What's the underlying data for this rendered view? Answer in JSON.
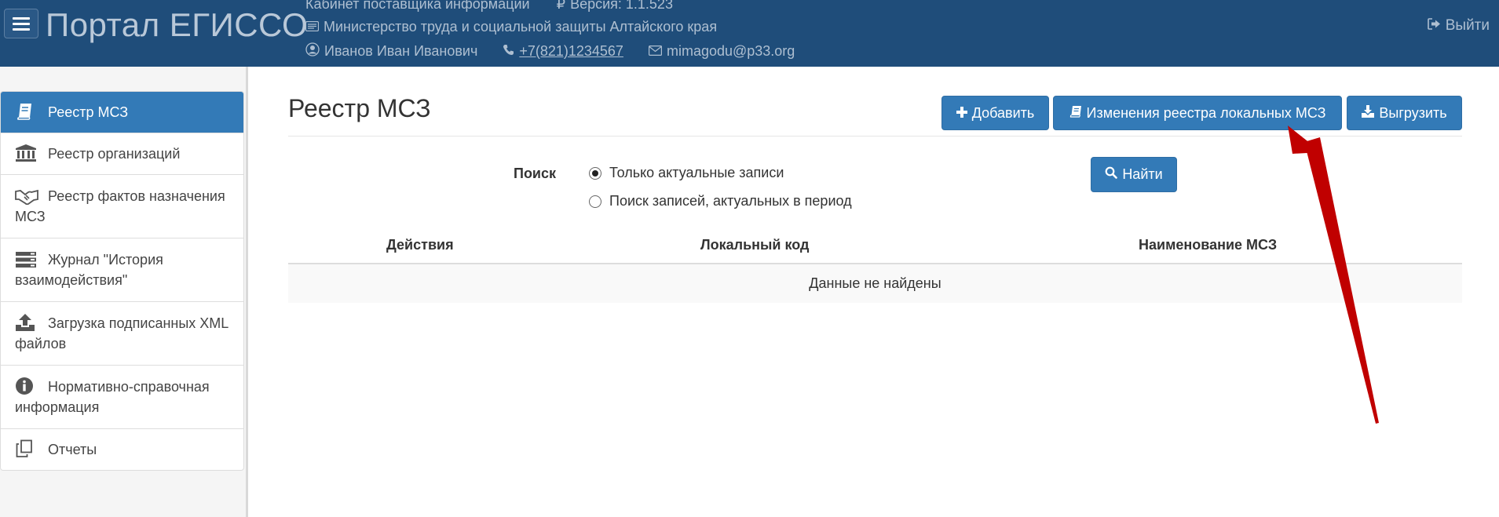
{
  "header": {
    "brand": "Портал ЕГИССО",
    "cabinet": "Кабинет поставщика информации",
    "version": "Версия: 1.1.523",
    "ministry": "Министерство труда и социальной защиты Алтайского края",
    "user": "Иванов Иван Иванович",
    "phone": "+7(821)1234567",
    "email": "mimagodu@p33.org",
    "logout": "Выйти"
  },
  "sidebar": {
    "items": [
      {
        "label": "Реестр МСЗ",
        "icon": "book-icon",
        "active": true
      },
      {
        "label": "Реестр организаций",
        "icon": "institution-icon"
      },
      {
        "label": "Реестр фактов назначения МСЗ",
        "icon": "handshake-icon"
      },
      {
        "label": "Журнал \"История взаимодействия\"",
        "icon": "server-icon"
      },
      {
        "label": "Загрузка подписанных XML файлов",
        "icon": "upload-icon"
      },
      {
        "label": "Нормативно-справочная информация",
        "icon": "info-icon"
      },
      {
        "label": "Отчеты",
        "icon": "copy-icon"
      }
    ]
  },
  "main": {
    "title": "Реестр МСЗ",
    "buttons": {
      "add": "Добавить",
      "changes": "Изменения реестра локальных МСЗ",
      "export": "Выгрузить"
    },
    "search": {
      "label": "Поиск",
      "option_current": "Только актуальные записи",
      "option_period": "Поиск записей, актуальных в период",
      "selected": "Только актуальные записи",
      "find": "Найти"
    },
    "table": {
      "columns": [
        "Действия",
        "Локальный код",
        "Наименование МСЗ"
      ],
      "empty": "Данные не найдены"
    }
  },
  "colors": {
    "header_bg": "#1f4d7a",
    "primary": "#337ab7",
    "annotation_arrow": "#c00000"
  }
}
